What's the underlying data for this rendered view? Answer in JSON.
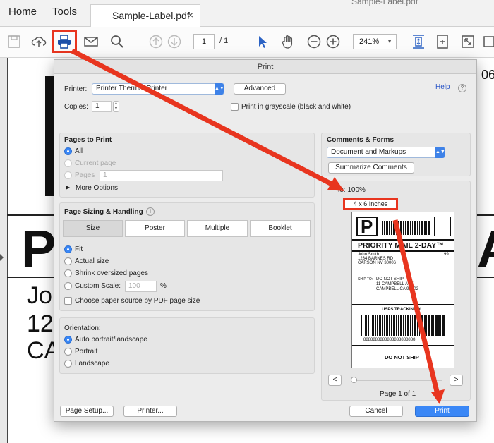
{
  "window": {
    "title": "Sample-Label.pdf"
  },
  "tabs": {
    "home": "Home",
    "tools": "Tools",
    "document": "Sample-Label.pdf",
    "close": "×"
  },
  "toolbar": {
    "page_current": "1",
    "page_total": "/ 1",
    "zoom": "241%"
  },
  "document": {
    "right_digits": "06",
    "big_left": "P",
    "big_right": "A",
    "addr_line1": "Jo",
    "addr_line2": "12",
    "addr_line3": "CA"
  },
  "dialog": {
    "title": "Print",
    "printer_label": "Printer:",
    "printer_value": "Printer Thermal Printer",
    "advanced_button": "Advanced",
    "help_link": "Help",
    "copies_label": "Copies:",
    "copies_value": "1",
    "grayscale_label": "Print in grayscale (black and white)",
    "pages_to_print": {
      "heading": "Pages to Print",
      "all": "All",
      "current_page": "Current page",
      "pages": "Pages",
      "pages_value": "1",
      "more_options": "More Options"
    },
    "sizing": {
      "heading": "Page Sizing & Handling",
      "tabs": [
        "Size",
        "Poster",
        "Multiple",
        "Booklet"
      ],
      "fit": "Fit",
      "actual_size": "Actual size",
      "shrink": "Shrink oversized pages",
      "custom_scale": "Custom Scale:",
      "custom_scale_value": "100",
      "percent": "%",
      "paper_source": "Choose paper source by PDF page size"
    },
    "orientation": {
      "heading": "Orientation:",
      "auto": "Auto portrait/landscape",
      "portrait": "Portrait",
      "landscape": "Landscape"
    },
    "comments": {
      "heading": "Comments & Forms",
      "select_value": "Document and Markups",
      "summarize_button": "Summarize Comments"
    },
    "preview": {
      "scale_text": "le: 100%",
      "size_text": "4 x 6 Inches",
      "page_indicator": "Page 1 of 1",
      "prev": "<",
      "next": ">"
    },
    "page_setup_button": "Page Setup...",
    "printer_button": "Printer...",
    "cancel_button": "Cancel",
    "print_button": "Print"
  },
  "label_preview": {
    "letter": "P",
    "service": "PRIORITY MAIL 2-DAY™",
    "from_name": "John Smith",
    "from_street": "1234 BARNES RD",
    "from_city": "CARSON NV 30006",
    "code": "99",
    "ship_to_tag": "SHIP TO:",
    "to_line1": "DO NOT SHIP",
    "to_line2": "11 CAMPBELL AVE",
    "to_line3": "CAMPBELL CA 99002",
    "tracking": "USPS TRACKING #",
    "tracking_number": "8888888888888888888888",
    "footer": "DO NOT SHIP"
  },
  "colors": {
    "highlight": "#e8351f",
    "accent": "#3a87f6"
  }
}
